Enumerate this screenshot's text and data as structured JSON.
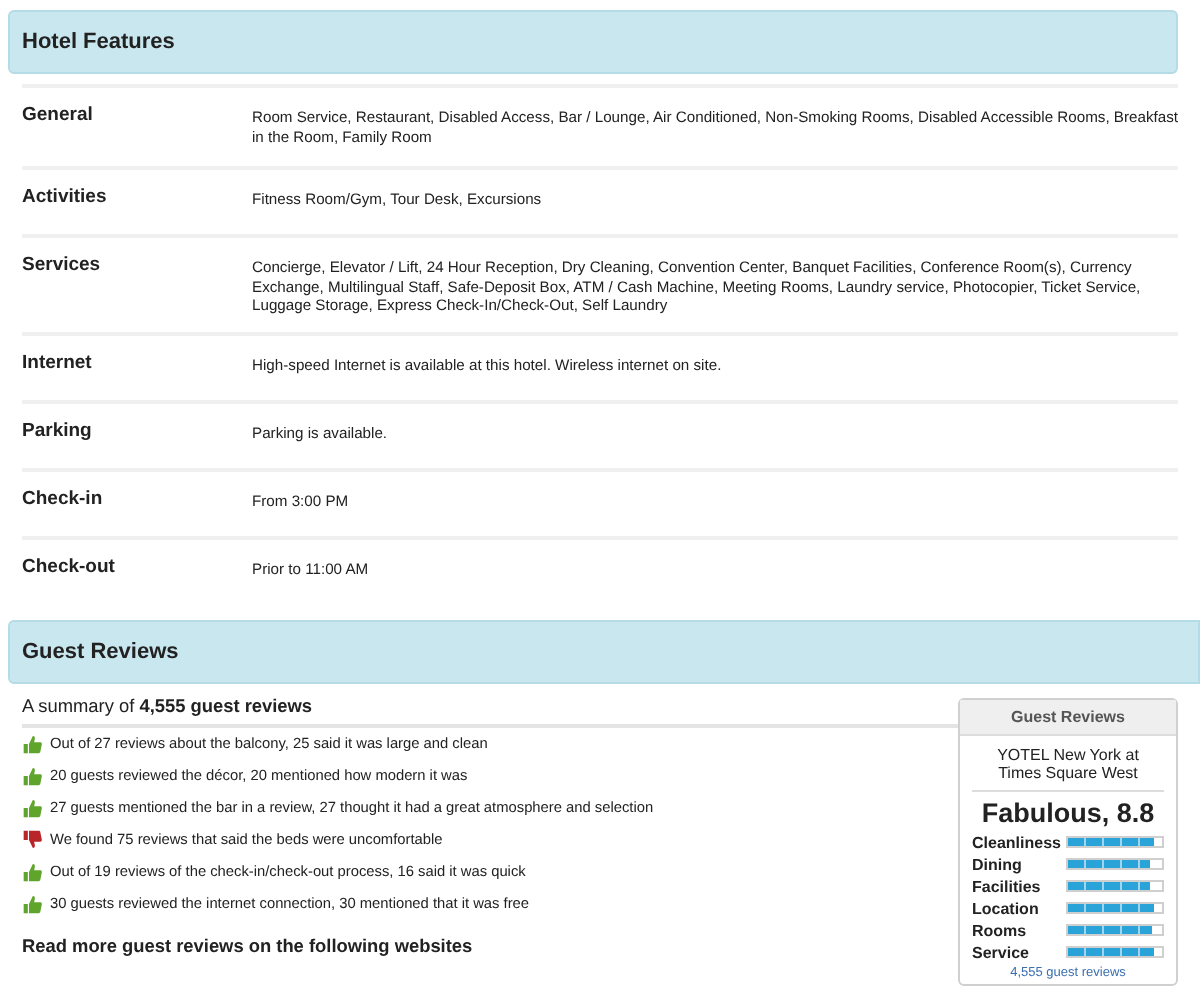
{
  "features": {
    "title": "Hotel Features",
    "rows": [
      {
        "label": "General",
        "value": "Room Service, Restaurant, Disabled Access, Bar / Lounge, Air Conditioned, Non-Smoking Rooms, Disabled Accessible Rooms, Breakfast in the Room, Family Room"
      },
      {
        "label": "Activities",
        "value": "Fitness Room/Gym, Tour Desk, Excursions"
      },
      {
        "label": "Services",
        "value": "Concierge, Elevator / Lift, 24 Hour Reception, Dry Cleaning, Convention Center, Banquet Facilities, Conference Room(s), Currency Exchange, Multilingual Staff, Safe-Deposit Box, ATM / Cash Machine, Meeting Rooms, Laundry service, Photocopier, Ticket Service, Luggage Storage, Express Check-In/Check-Out, Self Laundry"
      },
      {
        "label": "Internet",
        "value": "High-speed Internet is available at this hotel. Wireless internet on site."
      },
      {
        "label": "Parking",
        "value": "Parking is available."
      },
      {
        "label": "Check-in",
        "value": "From 3:00 PM"
      },
      {
        "label": "Check-out",
        "value": "Prior to 11:00 AM"
      }
    ]
  },
  "reviews": {
    "title": "Guest Reviews",
    "summary": "A summary of **4,555 guest reviews**",
    "items": [
      {
        "kind": "positive",
        "text": "Out of 27 reviews about the balcony, 25 said it was large and clean"
      },
      {
        "kind": "positive",
        "text": "20 guests reviewed the décor, 20 mentioned how modern it was"
      },
      {
        "kind": "positive",
        "text": "27 guests mentioned the bar in a review, 27 thought it had a great atmosphere and selection"
      },
      {
        "kind": "negative",
        "text": "We found 75 reviews that said the beds were uncomfortable"
      },
      {
        "kind": "positive",
        "text": "Out of 19 reviews of the check-in/check-out process, 16 said it was quick"
      },
      {
        "kind": "positive",
        "text": "30 guests reviewed the internet connection, 30 mentioned that it was free"
      }
    ],
    "more_heading": "Read more guest reviews on the following websites",
    "panel": {
      "title": "Guest Reviews",
      "hotel": "YOTEL New York at Times Square West",
      "score": "Fabulous, 8.8",
      "ratings": [
        {
          "name": "Cleanliness",
          "level": 0.92
        },
        {
          "name": "Dining",
          "level": 0.88
        },
        {
          "name": "Facilities",
          "level": 0.88
        },
        {
          "name": "Location",
          "level": 0.92
        },
        {
          "name": "Rooms",
          "level": 0.9
        },
        {
          "name": "Service",
          "level": 0.92
        }
      ],
      "count": "4,555 guest reviews"
    }
  }
}
